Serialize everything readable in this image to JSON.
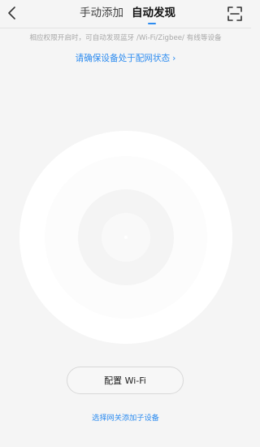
{
  "header": {
    "tabs": [
      {
        "label": "手动添加",
        "active": false
      },
      {
        "label": "自动发现",
        "active": true
      }
    ],
    "back_icon": "chevron-left-icon",
    "scan_icon": "scan-icon"
  },
  "hint": "相应权限开启时，可自动发现蓝牙 /Wi-Fi/Zigbee/ 有线等设备",
  "network_link": {
    "label": "请确保设备处于配网状态",
    "chevron": "›"
  },
  "wifi_button": {
    "label": "配置 Wi-Fi"
  },
  "gateway_link": {
    "label": "选择网关添加子设备"
  },
  "colors": {
    "accent": "#2d8cf0",
    "background": "#f5f5f5"
  }
}
